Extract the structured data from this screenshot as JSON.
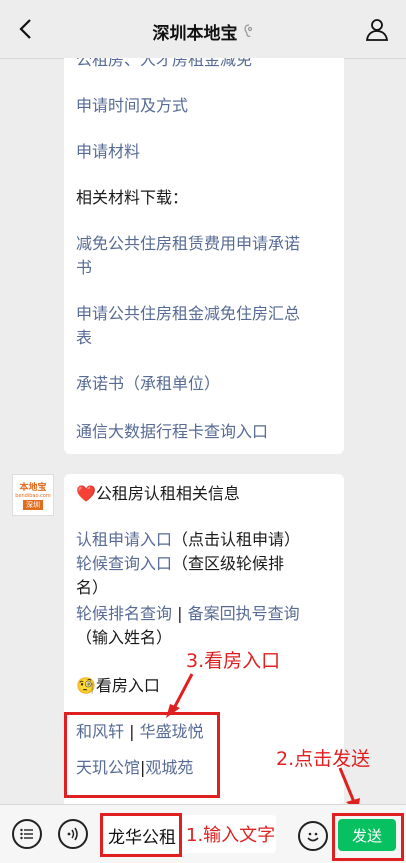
{
  "nav": {
    "title": "深圳本地宝"
  },
  "message1": {
    "lines": [
      "公租房、人才房租金减免",
      "申请时间及方式",
      "申请材料",
      "相关材料下载：",
      "减免公共住房租赁费用申请承诺",
      "书",
      "申请公共住房租金减免住房汇总",
      "表",
      "承诺书（承租单位）",
      "通信大数据行程卡查询入口"
    ]
  },
  "avatar": {
    "brand": "本地宝",
    "domain": "bendibao.com",
    "city": "深圳"
  },
  "message2": {
    "heading_emoji": "❤️",
    "heading": "公租房认租相关信息",
    "link_rent": "认租申请入口",
    "paren_rent": "（点击认租申请）",
    "link_queue": "轮候查询入口",
    "paren_queue": "（查区级轮候排",
    "paren_queue2": "名）",
    "link_rank": "轮候排名查询",
    "sep1": "|",
    "link_record": "备案回执号查询",
    "paren_name": "（输入姓名）",
    "viewing_emoji": "🧐",
    "viewing_heading": "看房入口",
    "link_hefengxuan": "和风轩",
    "sep2": "|",
    "link_huasheng": "华盛珑悦",
    "link_tianji": "天玑公馆",
    "sep3": "|",
    "link_guancheng": "观城苑"
  },
  "annotations": {
    "step3": "3.看房入口",
    "step2": "2.点击发送",
    "step1": "1.输入文字"
  },
  "input_bar": {
    "value": "龙华公租",
    "send_label": "发送"
  },
  "colors": {
    "link": "#576b95",
    "annotation": "#e02020",
    "send": "#07c160"
  }
}
